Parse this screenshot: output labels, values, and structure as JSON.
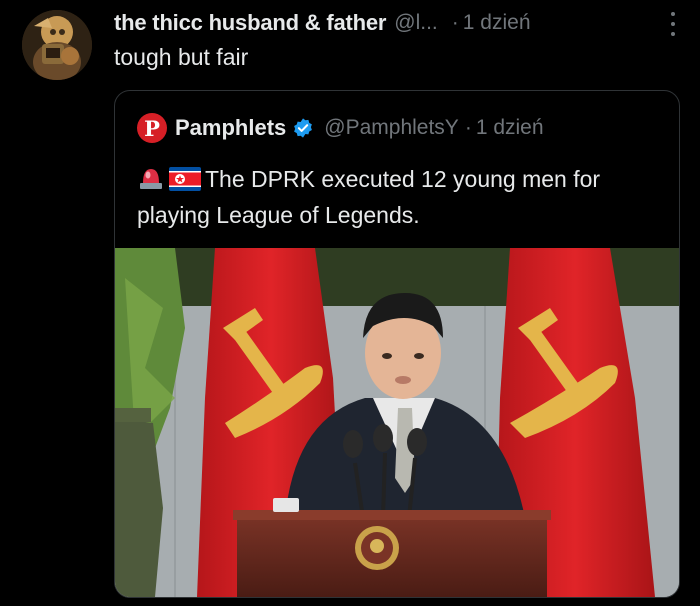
{
  "post": {
    "display_name": "the thicc husband & father",
    "handle": "@l...",
    "separator": "·",
    "time": "1 dzień",
    "text": "tough but fair"
  },
  "quote": {
    "logo_letter": "P",
    "display_name": "Pamphlets",
    "handle": "@PamphletsY",
    "separator": "·",
    "time": "1 dzień",
    "emojis": [
      "rotating-light-icon",
      "north-korea-flag-icon"
    ],
    "text": "The DPRK executed 12 young men for playing League of Legends.",
    "media_description": "photo"
  },
  "colors": {
    "background": "#000000",
    "text_primary": "#e7e9ea",
    "text_secondary": "#71767b",
    "border": "#2f3336",
    "verified_blue": "#1d9bf0",
    "logo_red": "#d61f26",
    "flag_red": "#d01c1f"
  }
}
